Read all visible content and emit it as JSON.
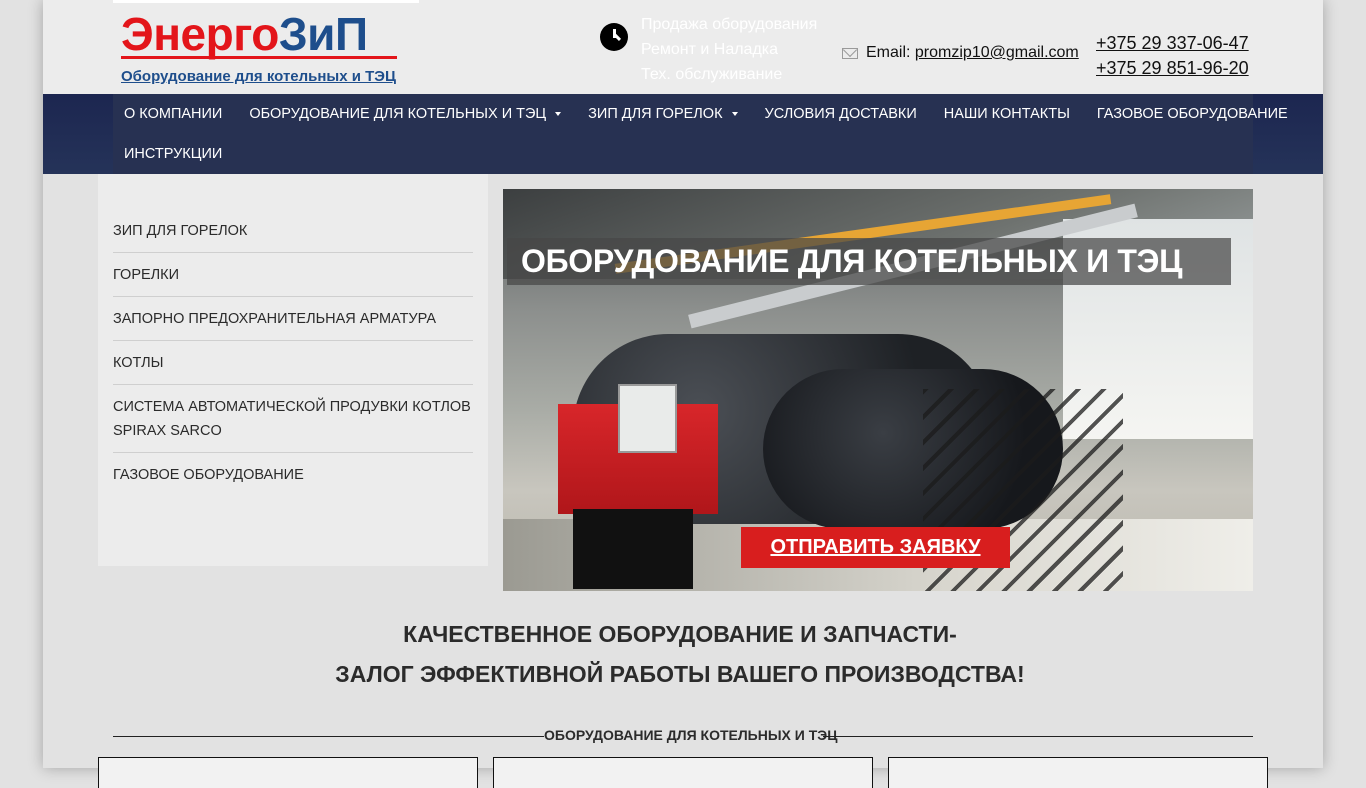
{
  "header": {
    "logo": {
      "name_red": "Энерго",
      "name_blue": "ЗиП",
      "subtitle": "Оборудование для котельных и ТЭЦ"
    },
    "services": [
      "Продажа оборудования",
      "Ремонт и Наладка",
      "Тех. обслуживание"
    ],
    "email_label": "Email: ",
    "email": "promzip10@gmail.com",
    "phones": [
      "+375 29 337-06-47",
      "+375 29 851-96-20"
    ]
  },
  "nav": {
    "items": [
      {
        "label": "О КОМПАНИИ",
        "has_submenu": false
      },
      {
        "label": "ОБОРУДОВАНИЕ ДЛЯ КОТЕЛЬНЫХ И ТЭЦ",
        "has_submenu": true
      },
      {
        "label": "ЗИП ДЛЯ ГОРЕЛОК",
        "has_submenu": true
      },
      {
        "label": "УСЛОВИЯ ДОСТАВКИ",
        "has_submenu": false
      },
      {
        "label": "НАШИ КОНТАКТЫ",
        "has_submenu": false
      },
      {
        "label": "ГАЗОВОЕ ОБОРУДОВАНИЕ",
        "has_submenu": false
      },
      {
        "label": "ИНСТРУКЦИИ",
        "has_submenu": false
      }
    ]
  },
  "sidebar": {
    "items": [
      {
        "label": "ЗИП ДЛЯ ГОРЕЛОК"
      },
      {
        "label": "ГОРЕЛКИ"
      },
      {
        "label": "ЗАПОРНО ПРЕДОХРАНИТЕЛЬНАЯ АРМАТУРА"
      },
      {
        "label": "КОТЛЫ"
      },
      {
        "label": "СИСТЕМА АВТОМАТИЧЕСКОЙ ПРОДУВКИ КОТЛОВ SPIRAX SARCO"
      },
      {
        "label": "ГАЗОВОЕ ОБОРУДОВАНИЕ"
      }
    ]
  },
  "hero": {
    "title": "ОБОРУДОВАНИЕ ДЛЯ КОТЕЛЬНЫХ И ТЭЦ",
    "button_label": "ОТПРАВИТЬ ЗАЯВКУ"
  },
  "tagline": {
    "line1": "КАЧЕСТВЕННОЕ ОБОРУДОВАНИЕ И ЗАПЧАСТИ-",
    "line2": "ЗАЛОГ ЭФФЕКТИВНОЙ РАБОТЫ ВАШЕГО ПРОИЗВОДСТВА!"
  },
  "section": {
    "title": "ОБОРУДОВАНИЕ ДЛЯ КОТЕЛЬНЫХ И ТЭЦ"
  },
  "colors": {
    "nav_bg": "#273152",
    "accent_red": "#d81e1e",
    "logo_red": "#e3151a",
    "logo_blue": "#1e4e8c"
  }
}
